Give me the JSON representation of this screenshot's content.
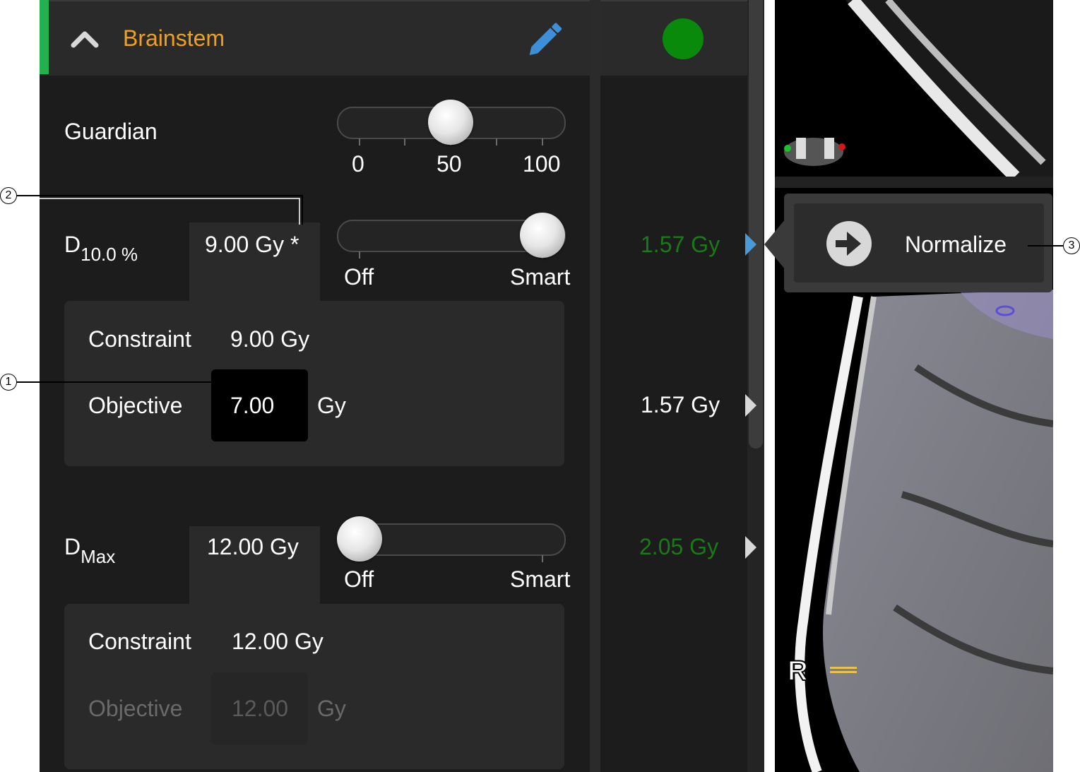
{
  "structure": {
    "name": "Brainstem",
    "status_color": "#0a8a0a"
  },
  "guardian": {
    "label": "Guardian",
    "value": 50,
    "scale": [
      "0",
      "50",
      "100"
    ]
  },
  "d10": {
    "label_main": "D",
    "label_sub": "10.0 %",
    "tab_value": "9.00 Gy *",
    "slider": {
      "left": "Off",
      "right": "Smart",
      "position": 1.0
    },
    "constraint_label": "Constraint",
    "constraint_value": "9.00 Gy",
    "objective_label": "Objective",
    "objective_value": "7.00",
    "objective_unit": "Gy",
    "result_top": "1.57 Gy",
    "result_top_color": "#1a7a1a",
    "result_bottom": "1.57 Gy"
  },
  "dmax": {
    "label_main": "D",
    "label_sub": "Max",
    "tab_value": "12.00 Gy",
    "slider": {
      "left": "Off",
      "right": "Smart",
      "position": 0.0
    },
    "constraint_label": "Constraint",
    "constraint_value": "12.00 Gy",
    "objective_label": "Objective",
    "objective_value": "12.00",
    "objective_unit": "Gy",
    "result": "2.05 Gy",
    "result_color": "#1a7a1a"
  },
  "normalize": {
    "label": "Normalize"
  },
  "viewer": {
    "orientation_label": "R"
  },
  "callouts": [
    "1",
    "2",
    "3"
  ]
}
